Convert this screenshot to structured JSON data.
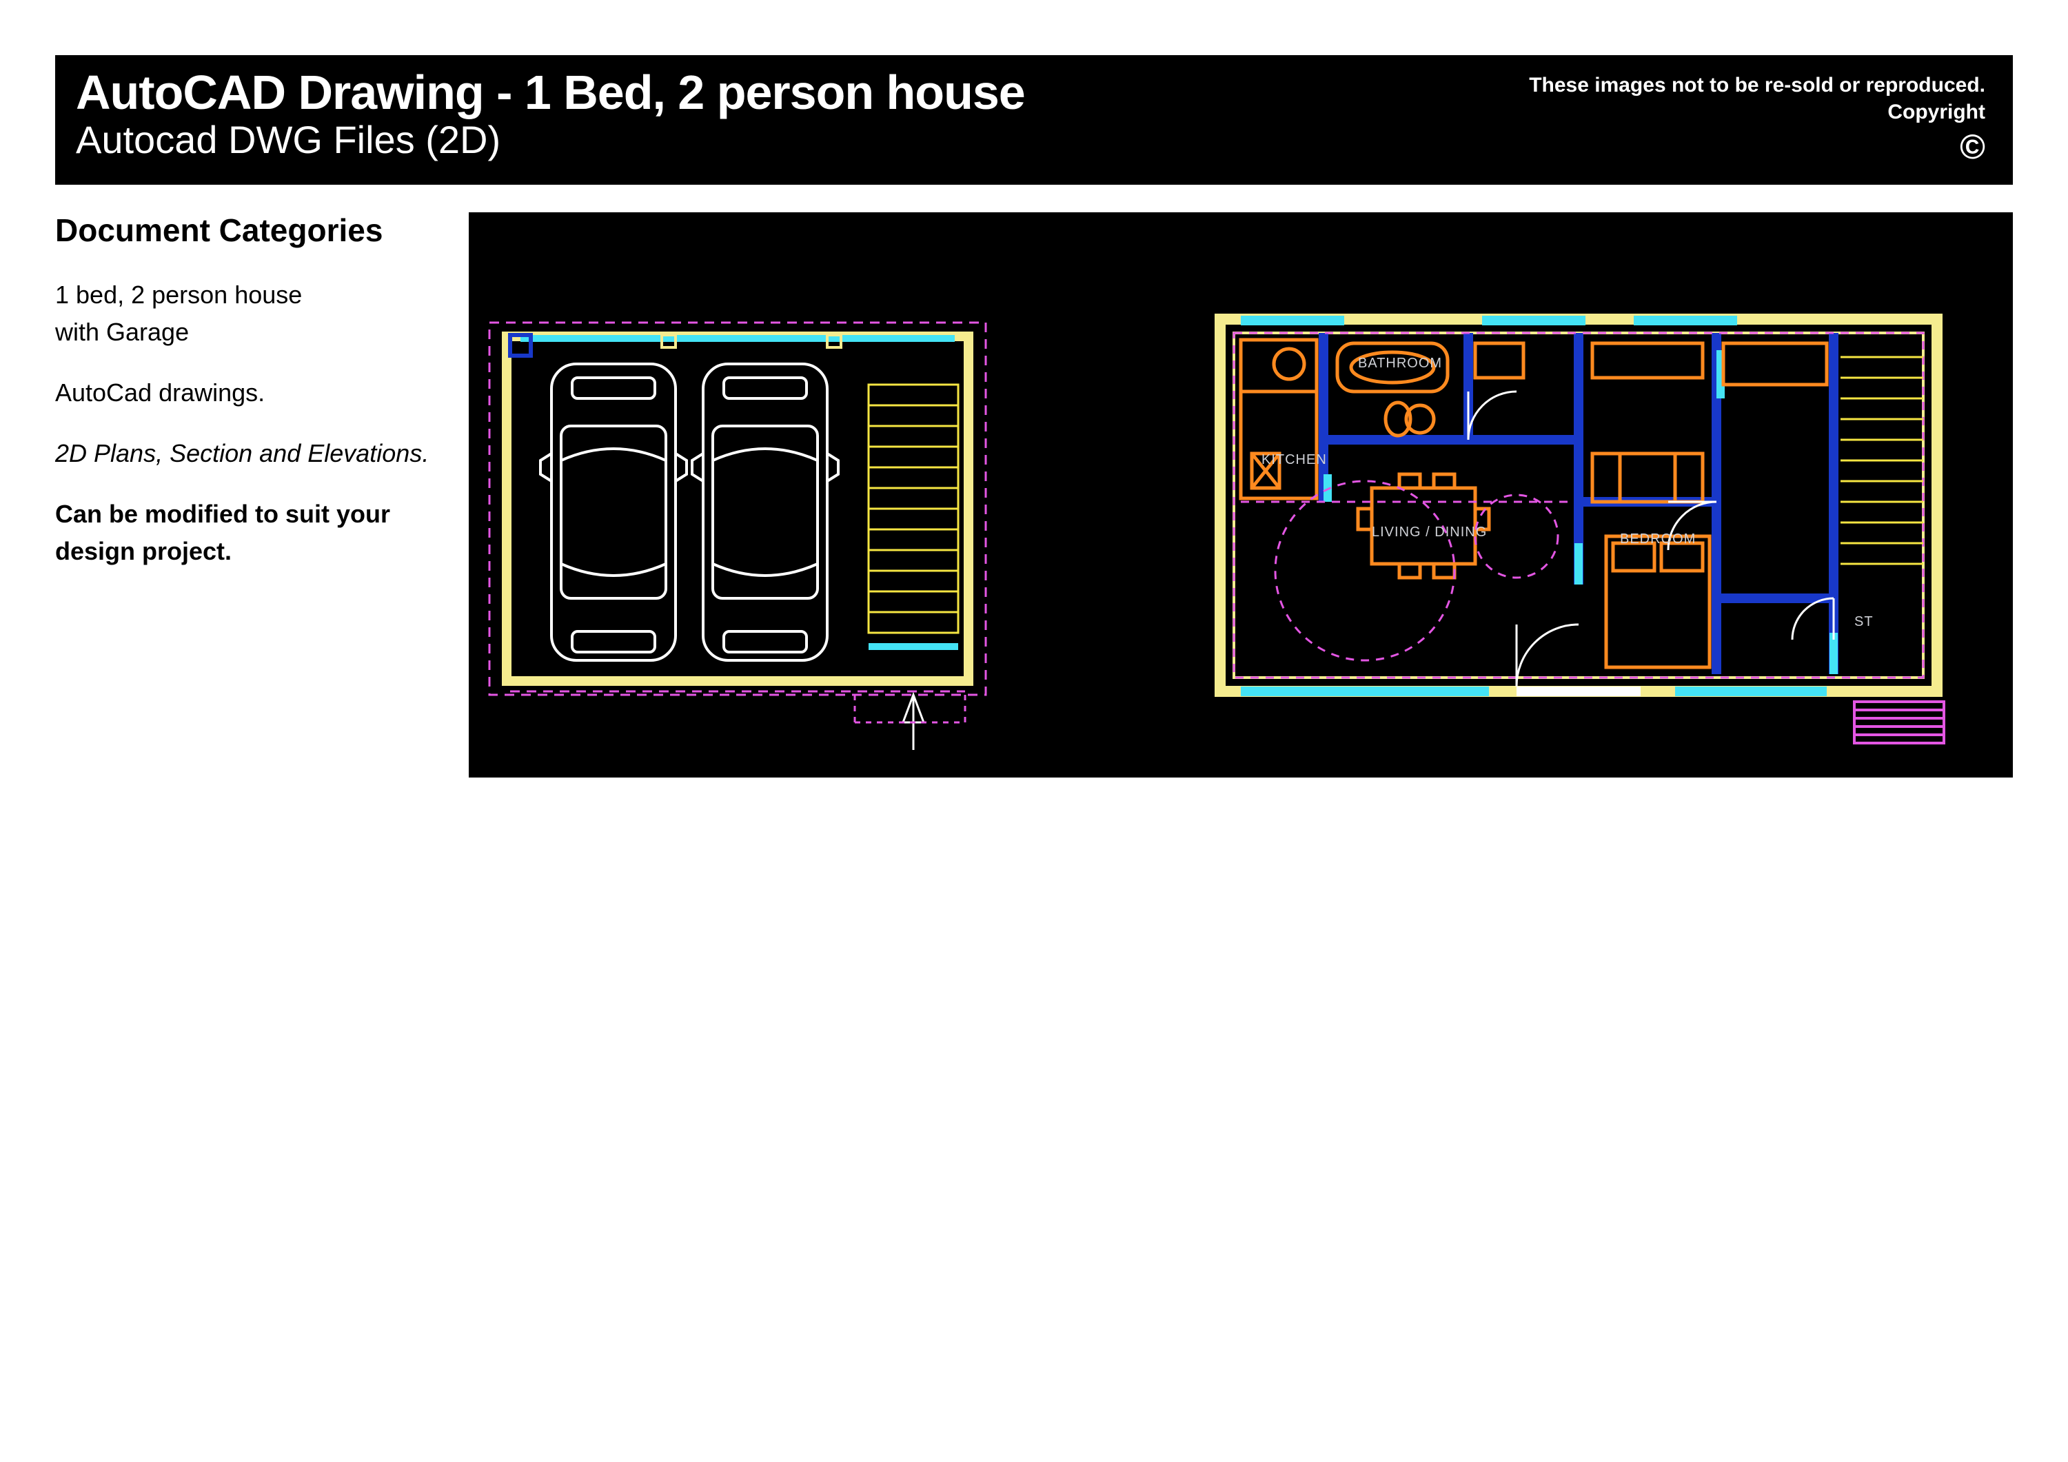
{
  "banner": {
    "title": "AutoCAD Drawing - 1 Bed, 2 person house",
    "subtitle": "Autocad DWG Files (2D)",
    "note1": "These images not to be re-sold or reproduced.",
    "note2": "Copyright",
    "icon": "©"
  },
  "sidebar": {
    "heading": "Document Categories",
    "line1": "1 bed, 2 person house",
    "line2": "with Garage",
    "line3": "AutoCad drawings.",
    "line4": "2D Plans, Section and Elevations.",
    "line5": "Can be modified to suit your design project."
  },
  "cad": {
    "rooms": {
      "kitchen": "KITCHEN",
      "bathroom": "BATHROOM",
      "living": "LIVING / DINING",
      "bedroom": "BEDROOM",
      "st": "ST"
    },
    "colors": {
      "wall": "#f5ec8f",
      "window": "#44e3f5",
      "furn": "#ff8a1f",
      "dash": "#e356e3",
      "partition": "#1838c9",
      "step": "#f5e542",
      "doormat": "#e356e3",
      "white": "#ffffff"
    }
  }
}
